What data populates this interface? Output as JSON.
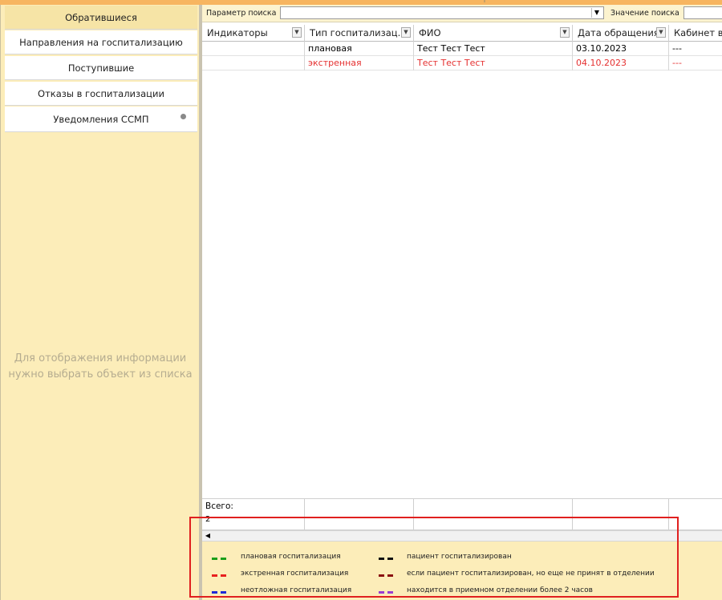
{
  "sidebar": {
    "items": [
      {
        "label": "Обратившиеся"
      },
      {
        "label": "Направления на госпитализацию"
      },
      {
        "label": "Поступившие"
      },
      {
        "label": "Отказы в госпитализации"
      },
      {
        "label": "Уведомления ССМП"
      }
    ],
    "empty_message_line1": "Для отображения информации",
    "empty_message_line2": "нужно выбрать объект из списка"
  },
  "search": {
    "param_label": "Параметр поиска",
    "param_value": "",
    "value_label": "Значение поиска",
    "value": ""
  },
  "table": {
    "columns": [
      "Индикаторы",
      "Тип госпитализац...",
      "ФИО",
      "Дата обращения",
      "Кабинет вр"
    ],
    "rows": [
      {
        "indicators": "",
        "type": "плановая",
        "fio": "Тест Тест Тест",
        "date": "03.10.2023",
        "cabinet": "---"
      },
      {
        "indicators": "",
        "type": "экстренная",
        "fio": "Тест Тест Тест",
        "date": "04.10.2023",
        "cabinet": "---"
      }
    ],
    "total_label": "Всего:",
    "total_value": "2"
  },
  "legend": {
    "items": [
      {
        "label": "плановая госпитализация",
        "color": "#1a9e1a"
      },
      {
        "label": "экстренная госпитализация",
        "color": "#e8201f"
      },
      {
        "label": "неотложная госпитализация",
        "color": "#1f2bd6"
      },
      {
        "label": "пациент госпитализирован",
        "color": "#111111"
      },
      {
        "label": "если пациент госпитализирован, но еще не принят в  отделении",
        "color": "#8b1010"
      },
      {
        "label": "находится в приемном отделении более 2 часов",
        "color": "#9a3fd1"
      }
    ]
  },
  "colors": {
    "panel": "#fcedb9",
    "row_emergency": "#e53030",
    "highlight_box": "#e0201f"
  }
}
